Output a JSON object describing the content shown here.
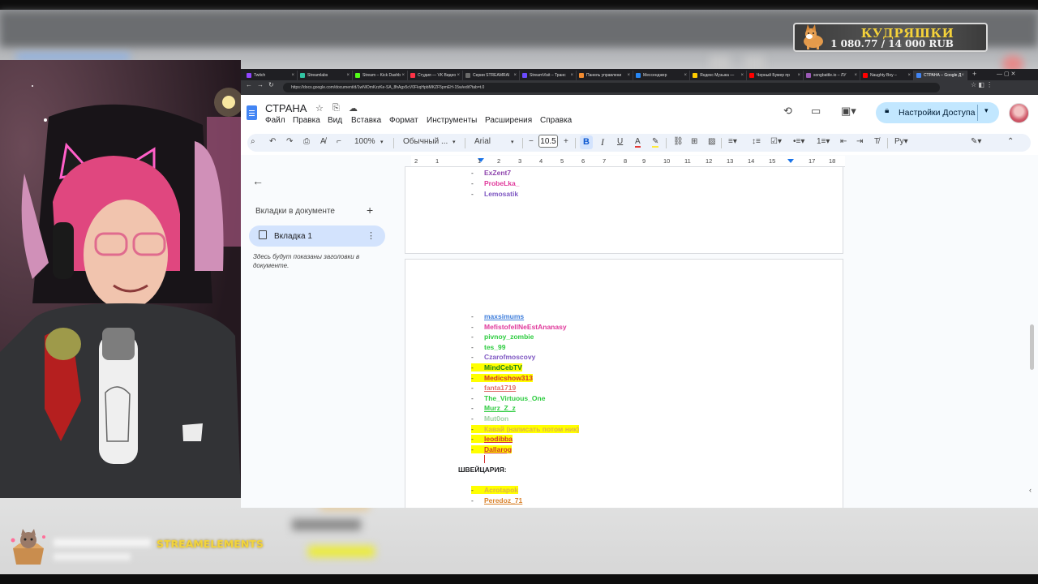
{
  "donation": {
    "title": "КУДРЯШКИ",
    "amount": "1 080.77 / 14 000 RUB"
  },
  "browser": {
    "tabs": [
      {
        "label": "Twitch",
        "color": "#9146ff"
      },
      {
        "label": "Streamlabs",
        "color": "#31c3a2"
      },
      {
        "label": "Stream – Kick Dashb",
        "color": "#53fc18"
      },
      {
        "label": "Студия — VK Видео",
        "color": "#ff3347"
      },
      {
        "label": "Серии STREAMRAI",
        "color": "#6a6a6a"
      },
      {
        "label": "StreamVisit – Транс",
        "color": "#6b4bff"
      },
      {
        "label": "Панель управлени",
        "color": "#f28b30"
      },
      {
        "label": "Мессенджер",
        "color": "#2787f5"
      },
      {
        "label": "Яндекс Музыка —",
        "color": "#ffcc00"
      },
      {
        "label": "Черный Бумер пр",
        "color": "#ff0000"
      },
      {
        "label": "songbattle.io – ЛУ",
        "color": "#9b59b6"
      },
      {
        "label": "Naughty Boy –",
        "color": "#ff0000"
      },
      {
        "label": "СТРАНА – Google Д",
        "color": "#4285f4"
      }
    ],
    "url": "https://docs.google.com/document/d/1wNlOmKzzKe-SA_8hAgx5cV0FkqHpbMKZF5pmEH-15w/edit?tab=t.0"
  },
  "docs": {
    "title": "СТРАНА",
    "menu": [
      "Файл",
      "Правка",
      "Вид",
      "Вставка",
      "Формат",
      "Инструменты",
      "Расширения",
      "Справка"
    ],
    "share_label": "Настройки Доступа",
    "toolbar": {
      "zoom": "100%",
      "style": "Обычный ...",
      "font": "Arial",
      "font_size": "10.5"
    },
    "sidebar": {
      "heading": "Вкладки в документе",
      "tab_label": "Вкладка 1",
      "hint": "Здесь будут показаны заголовки в документе."
    },
    "ruler": [
      "2",
      "1",
      "1",
      "2",
      "3",
      "4",
      "5",
      "6",
      "7",
      "8",
      "9",
      "10",
      "11",
      "12",
      "13",
      "14",
      "15",
      "16",
      "17",
      "18"
    ],
    "page1_lines": [
      {
        "text": "ExZent7",
        "color": "#8e44ad",
        "highlight": false
      },
      {
        "text": "ProbeLka_",
        "color": "#e0399b",
        "highlight": false
      },
      {
        "text": "Lemosatik",
        "color": "#7e57c2",
        "highlight": false
      }
    ],
    "page2_lines": [
      {
        "text": "maxsimums",
        "color": "#3d7ddb",
        "highlight": false,
        "underline": true
      },
      {
        "text": "MefistofellNeEstAnanasy",
        "color": "#e0399b",
        "highlight": false
      },
      {
        "text": "pivnoy_zombie",
        "color": "#2ecc40",
        "highlight": false
      },
      {
        "text": "tes_99",
        "color": "#2ecc40",
        "highlight": false
      },
      {
        "text": "Czarofmoscovy",
        "color": "#7e57c2",
        "highlight": false
      },
      {
        "text": "MindCebTV",
        "color": "#1a7f1a",
        "highlight": true
      },
      {
        "text": "Medicshow313",
        "color": "#d32f2f",
        "highlight": true
      },
      {
        "text": "fanta1719",
        "color": "#e06c6c",
        "highlight": false,
        "underline": true
      },
      {
        "text": "The_Virtuous_One",
        "color": "#2ecc40",
        "highlight": false
      },
      {
        "text": "Murz_Z_z",
        "color": "#2ecc40",
        "highlight": false,
        "underline": true
      },
      {
        "text": "Mut0on",
        "color": "#9bd0a0",
        "highlight": false
      },
      {
        "text": "Кавай (написать потом ник)",
        "color": "#e0b24a",
        "highlight": true
      },
      {
        "text": "leodibba",
        "color": "#d32f2f",
        "highlight": true,
        "underline": true
      },
      {
        "text": "Dallarog",
        "color": "#d32f2f",
        "highlight": true,
        "underline": true
      }
    ],
    "section_heading": "ШВЕЙЦАРИЯ:",
    "page2_lines_after": [
      {
        "text": "Acrotapok",
        "color": "#e0b24a",
        "highlight": true
      },
      {
        "text": "Peredoz_71",
        "color": "#d9822b",
        "highlight": false,
        "underline": true
      }
    ]
  },
  "overlay": {
    "alert_brand": "STREAMELEMENTS"
  }
}
